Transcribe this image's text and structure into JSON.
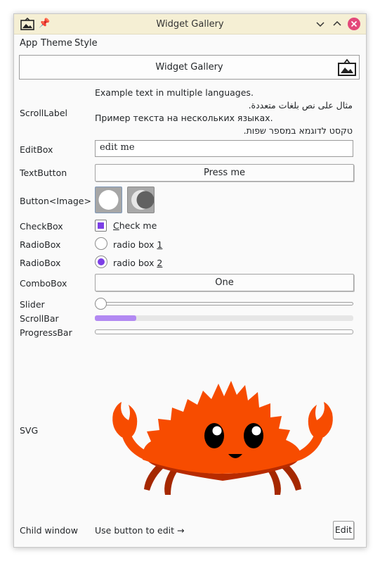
{
  "window": {
    "title": "Widget Gallery"
  },
  "titlebar": {
    "app_icon": "picture-icon",
    "pin_icon": "pin-icon",
    "min_icon": "chevron-down-icon",
    "max_icon": "chevron-up-icon",
    "close_icon": "close-icon"
  },
  "menu": {
    "items": [
      "App",
      "Theme",
      "Style"
    ]
  },
  "header": {
    "label": "Widget Gallery",
    "icon": "picture-icon"
  },
  "rows": {
    "scroll_label": "ScrollLabel",
    "edit_box": "EditBox",
    "text_button": "TextButton",
    "button_image": "Button<Image>",
    "check_box": "CheckBox",
    "radio_box_1": "RadioBox",
    "radio_box_2": "RadioBox",
    "combo_box": "ComboBox",
    "slider": "Slider",
    "scroll_bar": "ScrollBar",
    "progress_bar": "ProgressBar",
    "svg": "SVG",
    "child_window": "Child window"
  },
  "scroll_lines": [
    "Example text in multiple languages.",
    "مثال على نص بلغات متعددة.",
    "Пример текста на нескольких языках.",
    "טקסט לדוגמא במספר שפות."
  ],
  "edit_value": "edit me",
  "text_button_label": "Press me",
  "image_buttons": {
    "first": "sun-icon",
    "second": "moon-icon"
  },
  "check": {
    "rest": "heck me",
    "accel": "C",
    "checked": true
  },
  "radio1": {
    "prefix": "radio box ",
    "accel": "1",
    "selected": false
  },
  "radio2": {
    "prefix": "radio box ",
    "accel": "2",
    "selected": true
  },
  "combo_value": "One",
  "slider_value": 0,
  "scrollbar_fraction": 0.16,
  "progress_value": 0,
  "svg_image": "ferris-crab-icon",
  "child": {
    "text": "Use button to edit →",
    "button": "Edit"
  },
  "colors": {
    "accent": "#7c3fe6",
    "titlebar": "#f5efd4",
    "close": "#e3497a",
    "crab": "#f74c00",
    "crab_shadow": "#b72b00"
  }
}
